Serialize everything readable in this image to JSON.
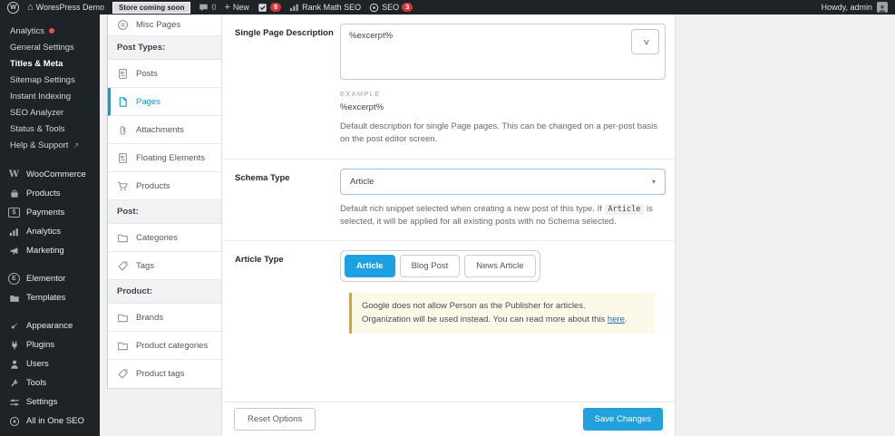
{
  "colors": {
    "accent_blue": "#069de3",
    "save_button_blue": "#23a1de",
    "badge_red": "#d63638",
    "notice_border": "#dba617",
    "notice_bg": "#fdf9e9",
    "admin_dark": "#1d2327"
  },
  "icons": {
    "wordpress-logo": "circled W",
    "home-icon": "house glyph",
    "comments-icon": "speech bubble",
    "updates-check-icon": "box with checkmark",
    "rank-math-icon": "bar chart",
    "seo-icon": "circled gauge",
    "avatar": "person square",
    "external-link-icon": "arrow up-right",
    "chevron-down-icon": "v chevron",
    "select-arrow-icon": "small down triangle"
  },
  "admin_bar": {
    "site_name": "WoresPress Demo",
    "store_badge": "Store coming soon",
    "comments_count": "0",
    "plus": "+",
    "new_label": "New",
    "updates_badge": "5",
    "rank_math_label": "Rank Math SEO",
    "seo_label": "SEO",
    "seo_badge": "3",
    "howdy": "Howdy, admin"
  },
  "sidebar": {
    "submenu": [
      {
        "label": "Analytics"
      },
      {
        "label": "General Settings"
      },
      {
        "label": "Titles & Meta"
      },
      {
        "label": "Sitemap Settings"
      },
      {
        "label": "Instant Indexing"
      },
      {
        "label": "SEO Analyzer"
      },
      {
        "label": "Status & Tools"
      },
      {
        "label": "Help & Support"
      }
    ],
    "menu": [
      {
        "label": "WooCommerce"
      },
      {
        "label": "Products"
      },
      {
        "label": "Payments"
      },
      {
        "label": "Analytics"
      },
      {
        "label": "Marketing"
      },
      {
        "label": "Elementor"
      },
      {
        "label": "Templates"
      },
      {
        "label": "Appearance"
      },
      {
        "label": "Plugins"
      },
      {
        "label": "Users"
      },
      {
        "label": "Tools"
      },
      {
        "label": "Settings"
      },
      {
        "label": "All in One SEO"
      }
    ]
  },
  "tabs": {
    "items": [
      {
        "label": "Misc Pages"
      },
      {
        "label": "Post Types:"
      },
      {
        "label": "Posts"
      },
      {
        "label": "Pages"
      },
      {
        "label": "Attachments"
      },
      {
        "label": "Floating Elements"
      },
      {
        "label": "Products"
      },
      {
        "label": "Post:"
      },
      {
        "label": "Categories"
      },
      {
        "label": "Tags"
      },
      {
        "label": "Product:"
      },
      {
        "label": "Brands"
      },
      {
        "label": "Product categories"
      },
      {
        "label": "Product tags"
      }
    ]
  },
  "content": {
    "row1": {
      "label": "Single Page Description",
      "value": "%excerpt%",
      "example_label": "EXAMPLE",
      "example_value": "%excerpt%",
      "help": "Default description for single Page pages. This can be changed on a per-post basis on the post editor screen."
    },
    "row2": {
      "label": "Schema Type",
      "value": "Article",
      "help_prefix": "Default rich snippet selected when creating a new post of this type. If ",
      "code": "Article",
      "help_suffix": " is selected, it will be applied for all existing posts with no Schema selected."
    },
    "row3": {
      "label": "Article Type",
      "buttons": [
        "Article",
        "Blog Post",
        "News Article"
      ],
      "notice_line1": "Google does not allow Person as the Publisher for articles.",
      "notice_line2": "Organization will be used instead. You can read more about this ",
      "notice_link": "here",
      "notice_end": "."
    },
    "footer": {
      "reset": "Reset Options",
      "save": "Save Changes"
    }
  }
}
